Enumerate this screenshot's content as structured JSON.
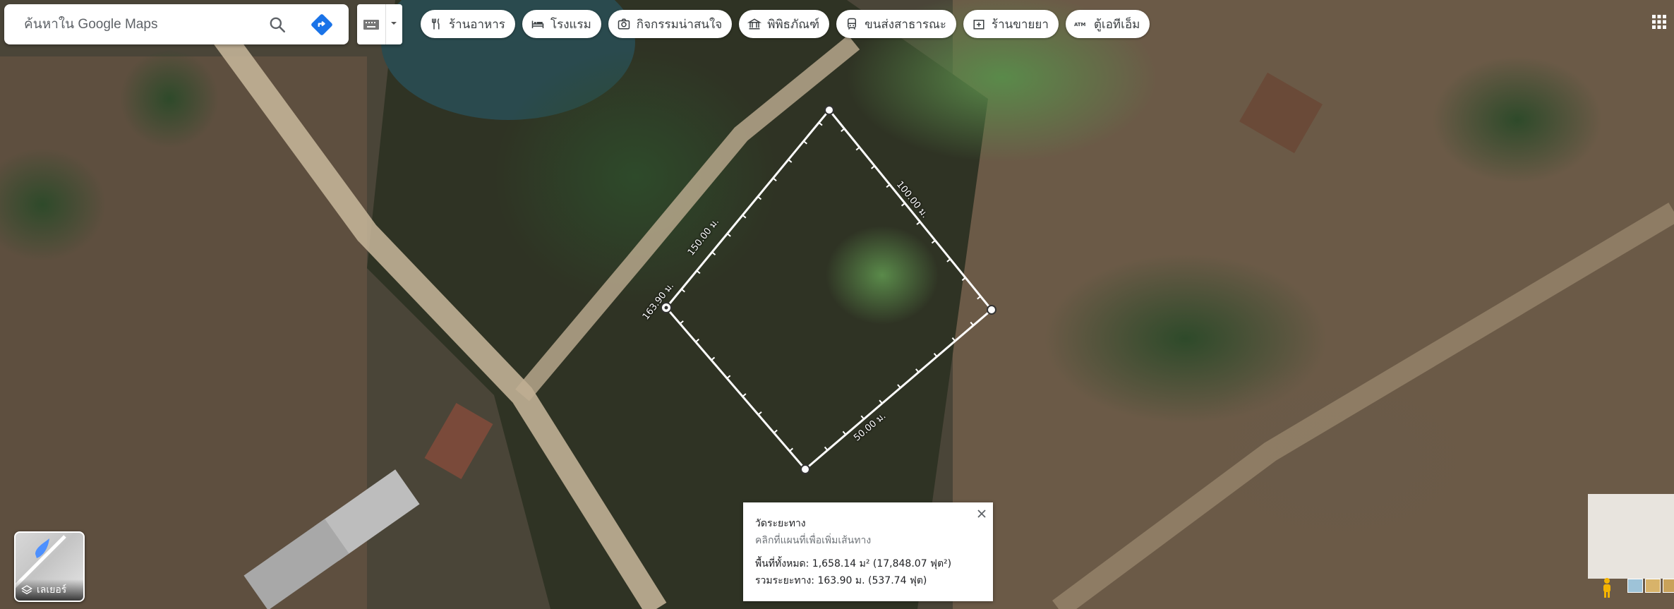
{
  "search": {
    "placeholder": "ค้นหาใน Google Maps"
  },
  "chips": [
    {
      "label": "ร้านอาหาร",
      "icon": "fork-knife-icon"
    },
    {
      "label": "โรงแรม",
      "icon": "bed-icon"
    },
    {
      "label": "กิจกรรมน่าสนใจ",
      "icon": "camera-icon"
    },
    {
      "label": "พิพิธภัณฑ์",
      "icon": "museum-icon"
    },
    {
      "label": "ขนส่งสาธารณะ",
      "icon": "transit-icon"
    },
    {
      "label": "ร้านขายยา",
      "icon": "pharmacy-icon"
    },
    {
      "label": "ตู้เอทีเอ็ม",
      "icon": "atm-icon"
    }
  ],
  "layers": {
    "label": "เลเยอร์"
  },
  "measure": {
    "title": "วัดระยะทาง",
    "hint": "คลิกที่แผนที่เพื่อเพิ่มเส้นทาง",
    "area": "พื้นที่ทั้งหมด: 1,658.14 ม² (17,848.07 ฟุต²)",
    "distance": "รวมระยะทาง: 163.90 ม. (537.74 ฟุต)"
  },
  "segments": [
    "100.00 ม.",
    "150.00 ม.",
    "163.90 ม.",
    "50.00 ม."
  ],
  "colors": {
    "accent": "#1a73e8",
    "chip_text": "#3c4043",
    "measure_line": "#ffffff"
  }
}
